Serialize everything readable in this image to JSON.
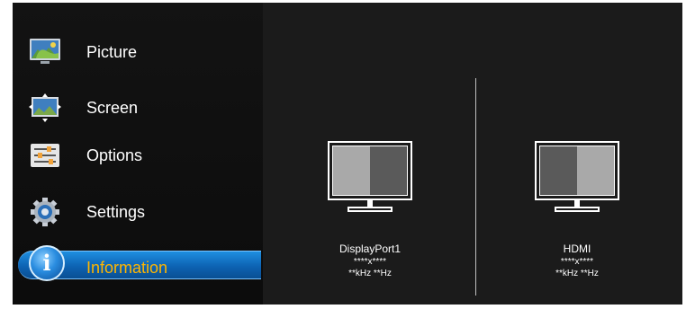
{
  "menu": {
    "items": [
      {
        "label": "Picture",
        "icon": "picture-icon"
      },
      {
        "label": "Screen",
        "icon": "screen-icon"
      },
      {
        "label": "Options",
        "icon": "options-icon"
      },
      {
        "label": "Settings",
        "icon": "settings-icon"
      },
      {
        "label": "Information",
        "icon": "info-icon",
        "selected": true
      }
    ],
    "selected_color": "#ffb600",
    "highlight_color": "#1a7fd6"
  },
  "sources": [
    {
      "name": "DisplayPort1",
      "resolution": "****x****",
      "frequency": "**kHz **Hz",
      "active_half": "left"
    },
    {
      "name": "HDMI",
      "resolution": "****x****",
      "frequency": "**kHz **Hz",
      "active_half": "right"
    }
  ]
}
